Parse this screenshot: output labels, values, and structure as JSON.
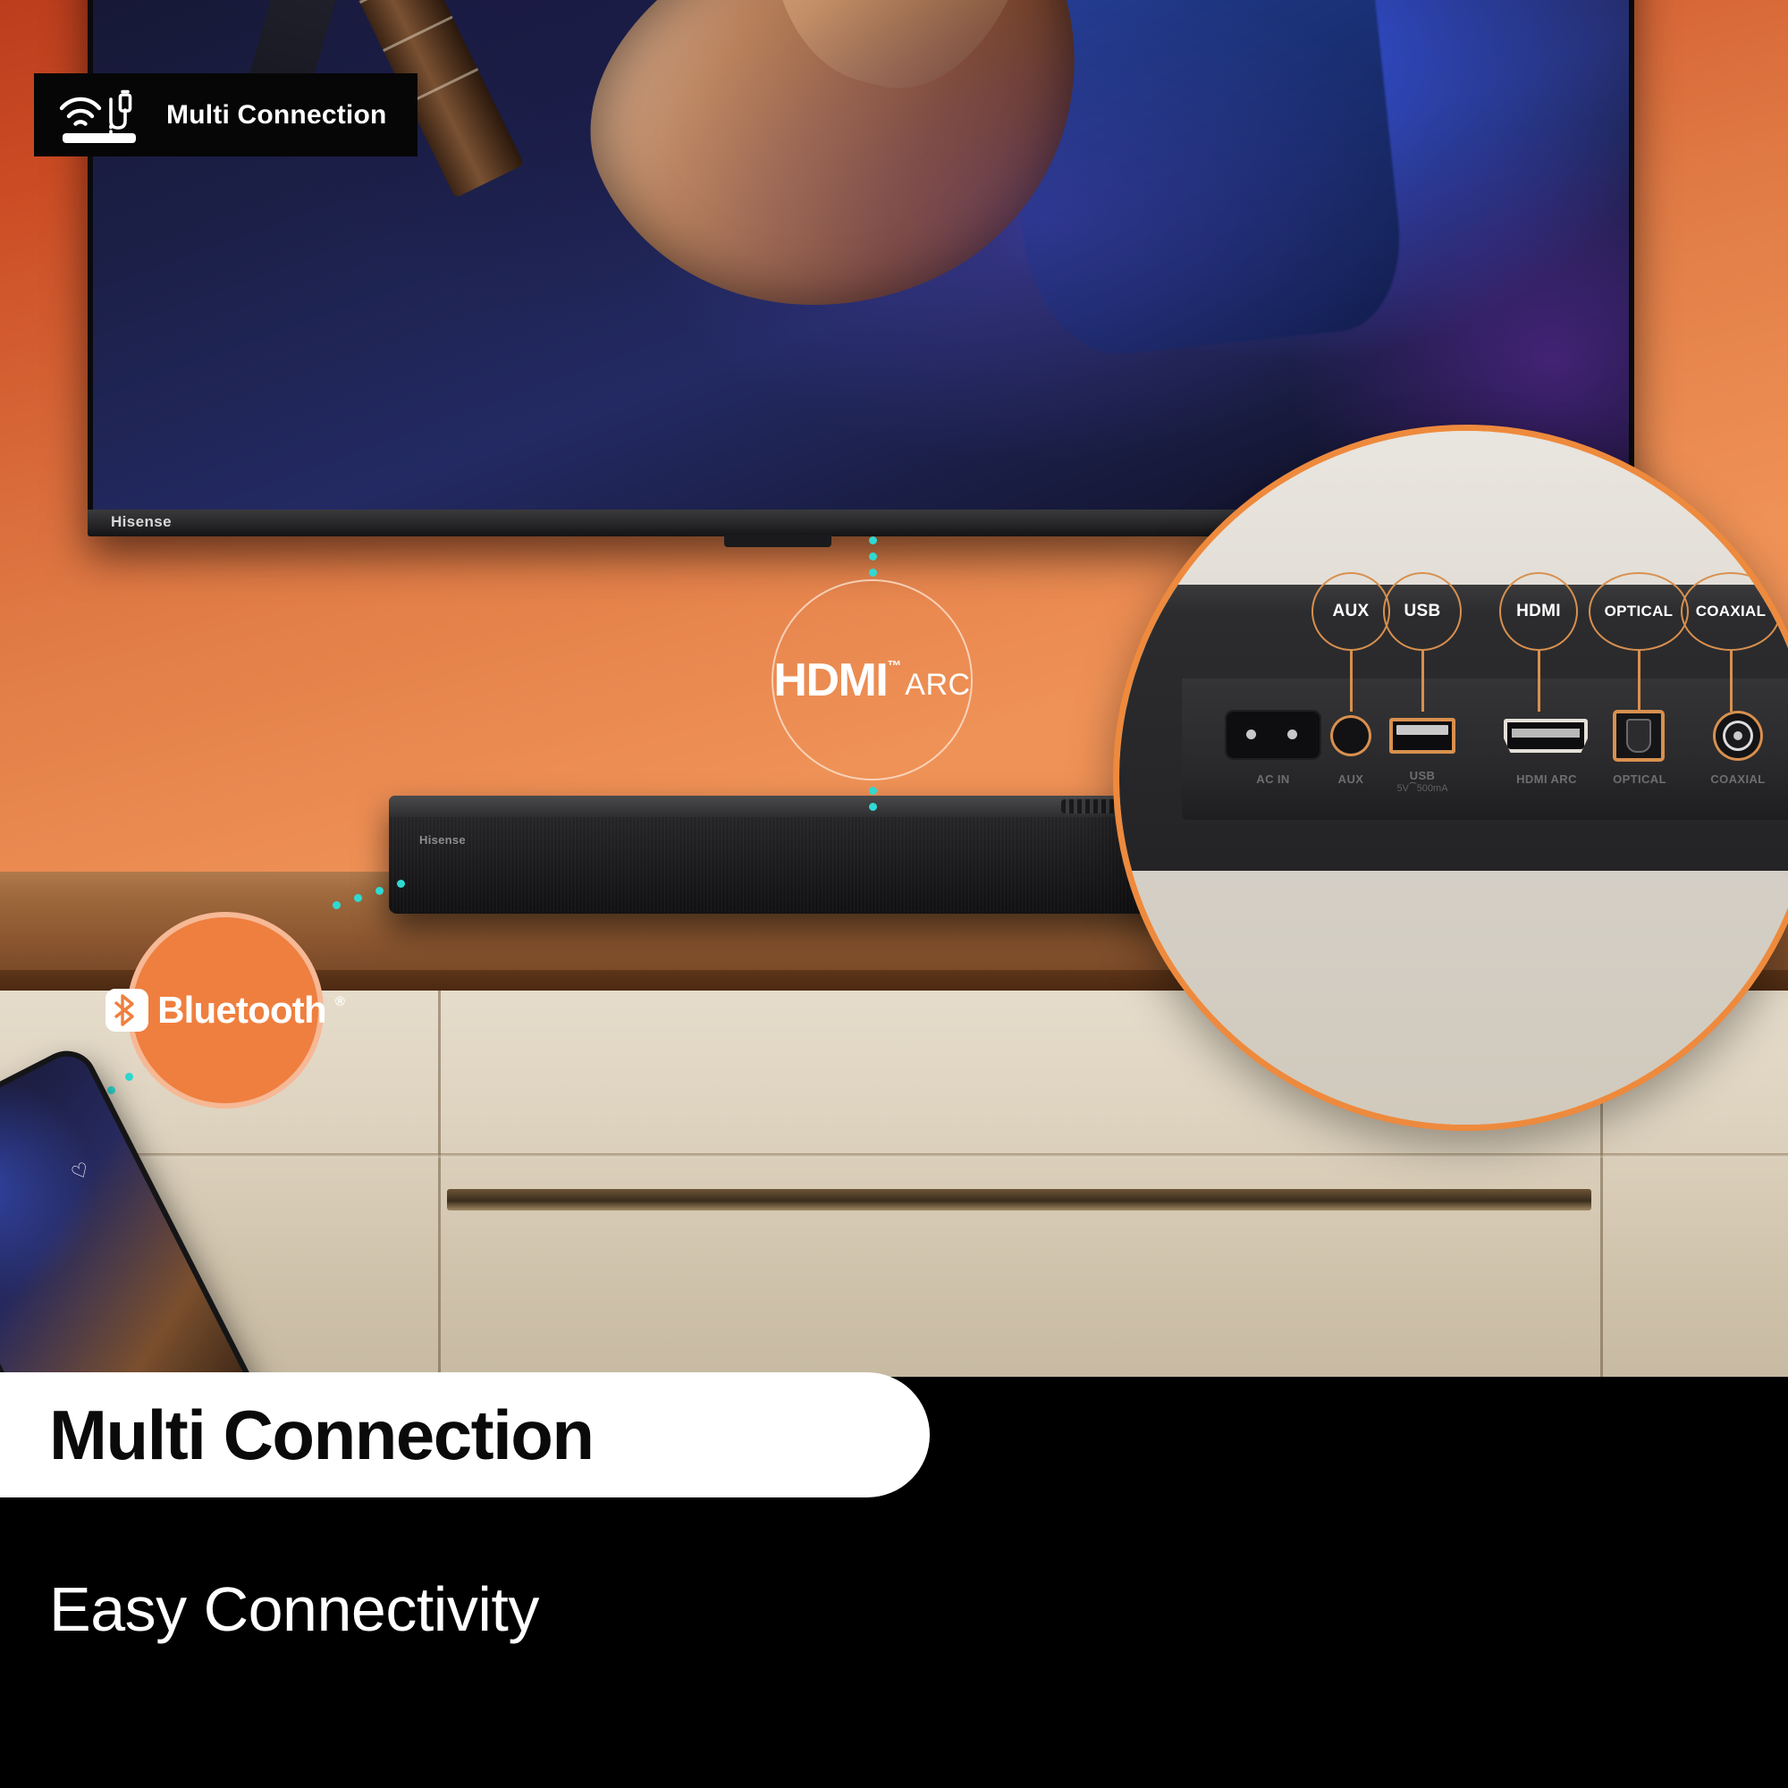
{
  "top_badge": {
    "label": "Multi Connection",
    "icons": [
      "wifi-signal-icon",
      "audio-jack-cable-icon",
      "soundbar-icon"
    ]
  },
  "scene": {
    "tv": {
      "brand_logo": "Hisense"
    },
    "soundbar": {
      "brand_logo": "Hisense"
    },
    "wall_color": "#cf5227",
    "accent_color": "#ee8a3d",
    "dot_color": "#2fd9d2"
  },
  "badges": {
    "hdmi": {
      "main": "HDMI",
      "tm": "™",
      "suffix": "ARC"
    },
    "bluetooth": {
      "label": "Bluetooth",
      "registered": "®",
      "mark": "bluetooth-rune-icon"
    }
  },
  "magnifier": {
    "callouts": [
      {
        "label": "AUX"
      },
      {
        "label": "USB"
      },
      {
        "label": "HDMI"
      },
      {
        "label": "OPTICAL"
      },
      {
        "label": "COAXIAL"
      }
    ],
    "ports": [
      {
        "name": "AC IN",
        "sub": "",
        "icon": "ac-power-inlet-icon"
      },
      {
        "name": "AUX",
        "sub": "",
        "icon": "aux-jack-icon"
      },
      {
        "name": "USB",
        "sub": "5V⏠500mA",
        "icon": "usb-port-icon"
      },
      {
        "name": "HDMI ARC",
        "sub": "",
        "icon": "hdmi-port-icon"
      },
      {
        "name": "OPTICAL",
        "sub": "",
        "icon": "optical-toslink-icon"
      },
      {
        "name": "COAXIAL",
        "sub": "",
        "icon": "coaxial-jack-icon"
      }
    ]
  },
  "footer": {
    "headline": "Multi Connection",
    "subhead": "Easy Connectivity"
  }
}
